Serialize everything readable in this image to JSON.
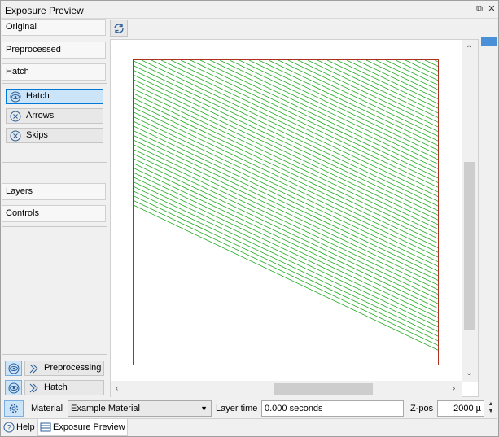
{
  "window": {
    "title": "Exposure Preview",
    "float_icon": "float-icon",
    "close_icon": "close-icon"
  },
  "sidebar": {
    "groups": [
      {
        "label": "Original"
      },
      {
        "label": "Preprocessed"
      },
      {
        "label": "Hatch"
      }
    ],
    "hatch_items": [
      {
        "label": "Hatch",
        "icon": "eye-icon",
        "active": true
      },
      {
        "label": "Arrows",
        "icon": "circle-x-icon",
        "active": false
      },
      {
        "label": "Skips",
        "icon": "circle-x-icon",
        "active": false
      }
    ],
    "lower_groups": [
      {
        "label": "Layers"
      },
      {
        "label": "Controls"
      }
    ],
    "bottom_buttons": [
      {
        "label": "Preprocessing",
        "visibility_icon": "eye-icon",
        "icon": "play-icon"
      },
      {
        "label": "Hatch",
        "visibility_icon": "eye-icon",
        "icon": "play-icon"
      }
    ]
  },
  "toolbar": {
    "refresh_icon": "refresh-icon"
  },
  "preview": {
    "hatch_color": "#1faa1f",
    "border_color": "#b03020"
  },
  "status": {
    "settings_icon": "gear-icon",
    "material_label": "Material",
    "material_value": "Example Material",
    "layer_time_label": "Layer time",
    "layer_time_value": "0.000 seconds",
    "zpos_label": "Z-pos",
    "zpos_value": "2000 µ"
  },
  "tabs": [
    {
      "label": "Help",
      "icon": "help-icon",
      "active": false
    },
    {
      "label": "Exposure Preview",
      "icon": "list-icon",
      "active": true
    }
  ]
}
